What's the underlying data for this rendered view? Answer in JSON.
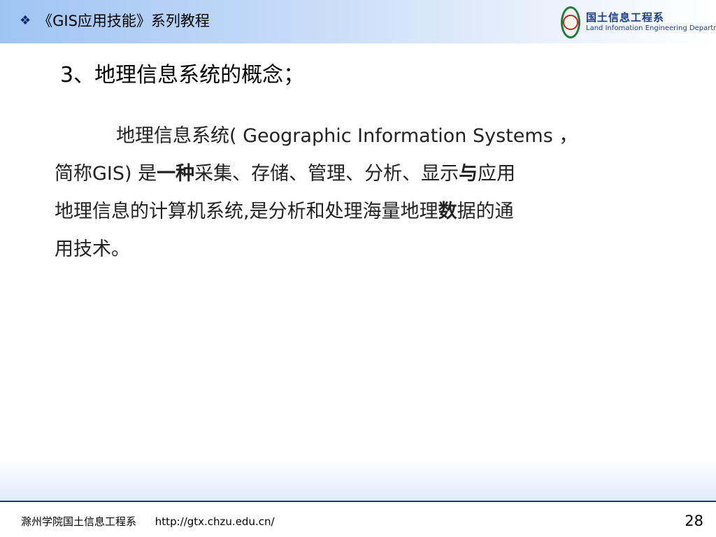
{
  "header": {
    "title": "《GIS应用技能》系列教程",
    "logo_cn": "国土信息工程系",
    "logo_en": "Land Infomation Engineering Department"
  },
  "slide": {
    "title": "3、地理信息系统的概念；",
    "body": {
      "p1": "地理信息系统( Geographic Information Systems ，",
      "p2": "简称GIS) 是",
      "p3_bold": "一种",
      "p4": "采集、存储、管理、分析、显示",
      "p5_bold": "与",
      "p6": "应用",
      "p7": "地理信息的计算机系统,是分析和处理海量地理",
      "p8_bold": "数",
      "p9": "据的通",
      "p10": "用技术。"
    }
  },
  "footer": {
    "org": "滁州学院国土信息工程系",
    "url": "http://gtx.chzu.edu.cn/",
    "page": "28"
  },
  "colors": {
    "header_start": "#9fc4f4",
    "footer_line": "#0d3b8f",
    "logo_text": "#1b3f8b"
  }
}
